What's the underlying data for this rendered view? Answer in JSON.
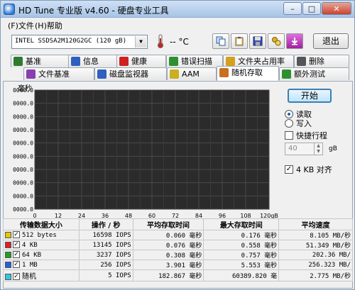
{
  "window": {
    "title": "HD Tune 专业版 v4.60 - 硬盘专业工具",
    "minimize": "–",
    "maximize": "□",
    "close": "✕"
  },
  "menu": {
    "file": "(F)文件",
    "help": "(H)帮助"
  },
  "toolbar": {
    "drive": "INTEL SSDSA2M120G2GC (120 gB)",
    "temperature": "-- °C",
    "exit_label": "退出",
    "icons": [
      "copy-icon",
      "clipboard-icon",
      "save-icon",
      "options-icon",
      "download-icon"
    ]
  },
  "tabs_top": [
    {
      "label": "基准",
      "icon": "benchmark-icon",
      "color": "#2f7a2f"
    },
    {
      "label": "信息",
      "icon": "info-icon",
      "color": "#2f5fbf"
    },
    {
      "label": "健康",
      "icon": "health-icon",
      "color": "#d02020"
    },
    {
      "label": "错误扫描",
      "icon": "error-scan-icon",
      "color": "#2f8f2f"
    },
    {
      "label": "文件夹占用率",
      "icon": "folder-icon",
      "color": "#d4a020"
    },
    {
      "label": "删除",
      "icon": "delete-icon",
      "color": "#555555"
    }
  ],
  "tabs_bottom": [
    {
      "label": "文件基准",
      "icon": "file-benchmark-icon",
      "color": "#8a3fb0"
    },
    {
      "label": "磁盘监视器",
      "icon": "disk-monitor-icon",
      "color": "#2f5fbf"
    },
    {
      "label": "AAM",
      "icon": "speaker-icon",
      "color": "#c8b020"
    },
    {
      "label": "随机存取",
      "icon": "random-access-icon",
      "color": "#c87020",
      "active": true
    },
    {
      "label": "额外测试",
      "icon": "extra-tests-icon",
      "color": "#2f8f2f"
    }
  ],
  "chart_data": {
    "type": "scatter",
    "title": "",
    "ylabel": "毫秒",
    "xlabel": "",
    "y_ticks": [
      "0000.0",
      "0000.0",
      "0000.0",
      "0000.0",
      "0000.0",
      "0000.0",
      "0000.0",
      "0000.0",
      "0000.0",
      "0000.0"
    ],
    "x_ticks": [
      "0",
      "12",
      "24",
      "36",
      "48",
      "60",
      "72",
      "84",
      "96",
      "108",
      "120gB"
    ],
    "xlim": [
      0,
      120
    ],
    "grid": true,
    "background": "#2b2b2b",
    "series": []
  },
  "controls": {
    "start_label": "开始",
    "read_label": "读取",
    "write_label": "写入",
    "short_stroke_label": "快捷行程",
    "short_stroke_value": "40",
    "short_stroke_unit": "gB",
    "align_label": "4 KB 对齐"
  },
  "results": {
    "headers": [
      "传输数据大小",
      "操作 / 秒",
      "平均存取时间",
      "最大存取时间",
      "平均速度"
    ],
    "rows": [
      {
        "color": "#e0c800",
        "size": "512 bytes",
        "ops": "16598 IOPS",
        "avg": "0.060 毫秒",
        "max": "0.176 毫秒",
        "speed": "8.105 MB/秒"
      },
      {
        "color": "#e02020",
        "size": "4 KB",
        "ops": "13145 IOPS",
        "avg": "0.076 毫秒",
        "max": "0.558 毫秒",
        "speed": "51.349 MB/秒"
      },
      {
        "color": "#20a020",
        "size": "64 KB",
        "ops": "3237 IOPS",
        "avg": "0.308 毫秒",
        "max": "0.757 毫秒",
        "speed": "202.36 MB/"
      },
      {
        "color": "#2060e0",
        "size": "1 MB",
        "ops": "256 IOPS",
        "avg": "3.901 毫秒",
        "max": "5.553 毫秒",
        "speed": "256.323 MB/"
      },
      {
        "color": "#30c8e0",
        "size": "随机",
        "ops": "5 IOPS",
        "avg": "182.867 毫秒",
        "max": "60389.820 毫",
        "speed": "2.775 MB/秒"
      }
    ]
  }
}
